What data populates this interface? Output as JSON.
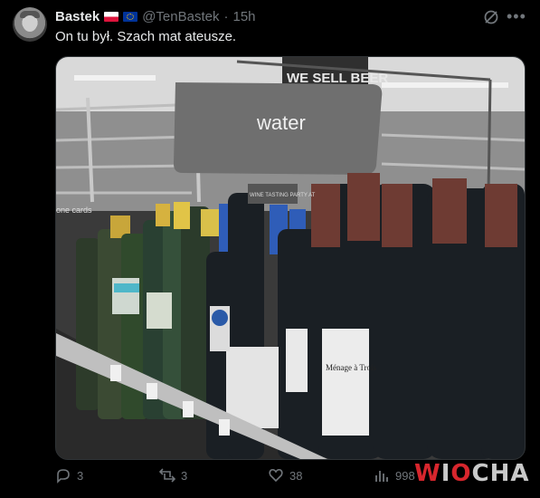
{
  "author": {
    "name": "Bastek",
    "handle": "@TenBastek",
    "separator": "·",
    "time": "15h",
    "flags": [
      "poland-flag",
      "eu-flag"
    ]
  },
  "tweet": {
    "text": "On tu był. Szach mat ateusze."
  },
  "media": {
    "sign_text": "water",
    "banner_text": "WE SELL BEER",
    "ceiling_text": "one cards",
    "labels": {
      "menage": "Ménage à Trois",
      "tasting": "WINE TASTING PARTY AT"
    }
  },
  "actions": {
    "replies": "3",
    "reposts": "3",
    "likes": "38",
    "views": "998"
  },
  "watermark": {
    "first": "W",
    "rest": "I",
    "mid": "O",
    "tail": "CHA"
  },
  "icons": {
    "grok": "grok-icon",
    "more": "more-icon",
    "reply": "reply-icon",
    "repost": "repost-icon",
    "like": "like-icon",
    "views": "views-icon"
  },
  "colors": {
    "background": "#000000",
    "text": "#e7e9ea",
    "muted": "#71767b",
    "watermark_red": "#d7262d"
  }
}
